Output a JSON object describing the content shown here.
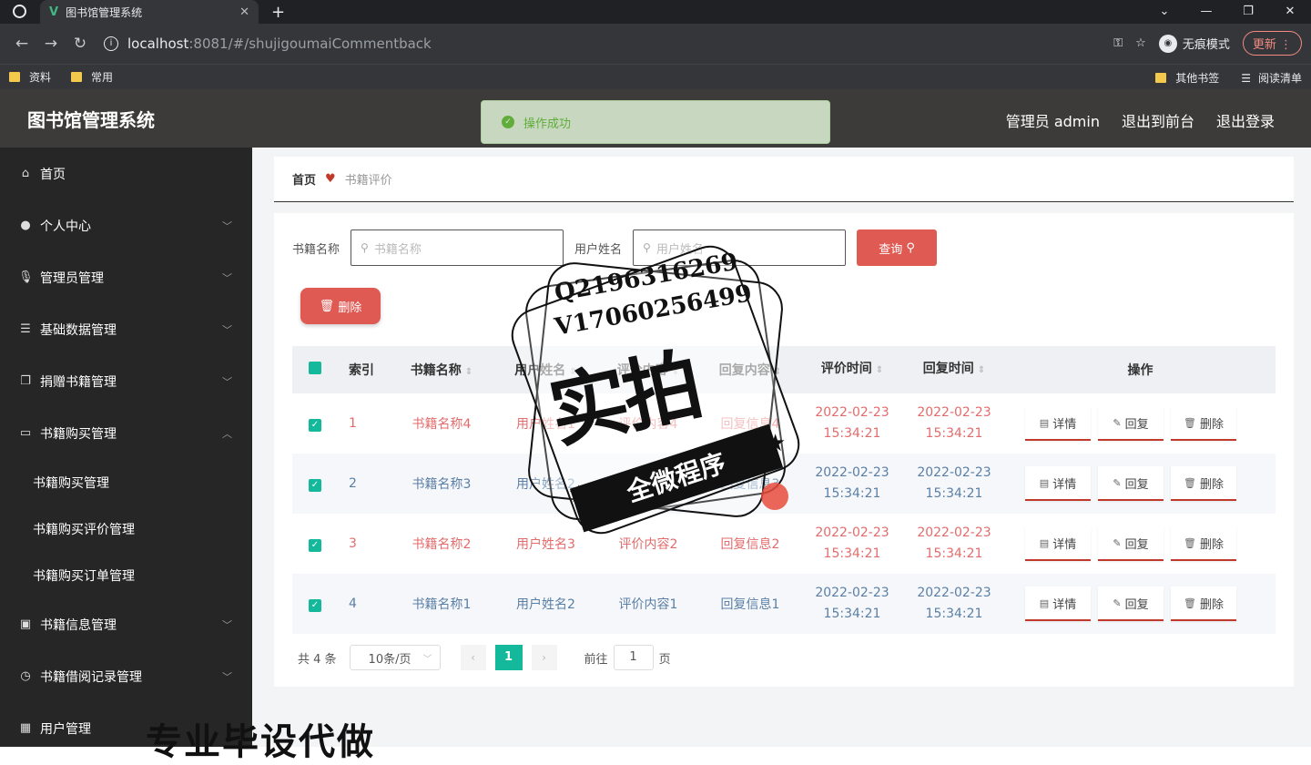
{
  "browser": {
    "tab_title": "图书馆管理系统",
    "tab_close": "✕",
    "new_tab": "+",
    "url_host": "localhost",
    "url_rest": ":8081/#/shujigoumaiCommentback",
    "incognito": "无痕模式",
    "update": "更新",
    "bookmarks": [
      "资料",
      "常用"
    ],
    "bookmarks_right": [
      "其他书签",
      "阅读清单"
    ]
  },
  "header": {
    "title": "图书馆管理系统",
    "user": "管理员 admin",
    "front": "退出到前台",
    "logout": "退出登录"
  },
  "toast": {
    "text": "操作成功"
  },
  "sidebar": {
    "items": [
      {
        "label": "首页",
        "icon": "home-icon"
      },
      {
        "label": "个人中心",
        "icon": "user-icon"
      },
      {
        "label": "管理员管理",
        "icon": "mic-icon"
      },
      {
        "label": "基础数据管理",
        "icon": "sliders-icon"
      },
      {
        "label": "捐赠书籍管理",
        "icon": "copy-icon"
      },
      {
        "label": "书籍购买管理",
        "icon": "cart-icon"
      }
    ],
    "sub": [
      "书籍购买管理",
      "书籍购买评价管理",
      "书籍购买订单管理"
    ],
    "items2": [
      {
        "label": "书籍信息管理",
        "icon": "book-icon"
      },
      {
        "label": "书籍借阅记录管理",
        "icon": "clock-icon"
      },
      {
        "label": "用户管理",
        "icon": "grid-icon"
      }
    ]
  },
  "breadcrumb": {
    "home": "首页",
    "current": "书籍评价"
  },
  "search": {
    "label1": "书籍名称",
    "placeholder1": "书籍名称",
    "label2": "用户姓名",
    "placeholder2": "用户姓名",
    "query": "查询"
  },
  "delete_label": "删除",
  "table": {
    "headers": [
      "索引",
      "书籍名称",
      "用户姓名",
      "评价内容",
      "回复内容",
      "评价时间",
      "回复时间",
      "操作"
    ],
    "rows": [
      {
        "idx": "1",
        "name": "书籍名称4",
        "user": "用户姓名1",
        "content": "评价内容4",
        "reply": "回复信息4",
        "t1a": "2022-02-23",
        "t1b": "15:34:21",
        "t2a": "2022-02-23",
        "t2b": "15:34:21"
      },
      {
        "idx": "2",
        "name": "书籍名称3",
        "user": "用户姓名2",
        "content": "评价内容3",
        "reply": "回复信息3",
        "t1a": "2022-02-23",
        "t1b": "15:34:21",
        "t2a": "2022-02-23",
        "t2b": "15:34:21"
      },
      {
        "idx": "3",
        "name": "书籍名称2",
        "user": "用户姓名3",
        "content": "评价内容2",
        "reply": "回复信息2",
        "t1a": "2022-02-23",
        "t1b": "15:34:21",
        "t2a": "2022-02-23",
        "t2b": "15:34:21"
      },
      {
        "idx": "4",
        "name": "书籍名称1",
        "user": "用户姓名2",
        "content": "评价内容1",
        "reply": "回复信息1",
        "t1a": "2022-02-23",
        "t1b": "15:34:21",
        "t2a": "2022-02-23",
        "t2b": "15:34:21"
      }
    ],
    "ops": {
      "detail": "详情",
      "reply": "回复",
      "delete": "删除"
    }
  },
  "pagination": {
    "total": "共 4 条",
    "size": "10条/页",
    "page": "1",
    "goto": "前往",
    "goto_val": "1",
    "page_unit": "页"
  },
  "watermark": {
    "line1": "Q2196316269",
    "line2": "V17060256499",
    "big": "实拍",
    "ribbon": "全微程序",
    "bottom": "专业毕设代做"
  }
}
